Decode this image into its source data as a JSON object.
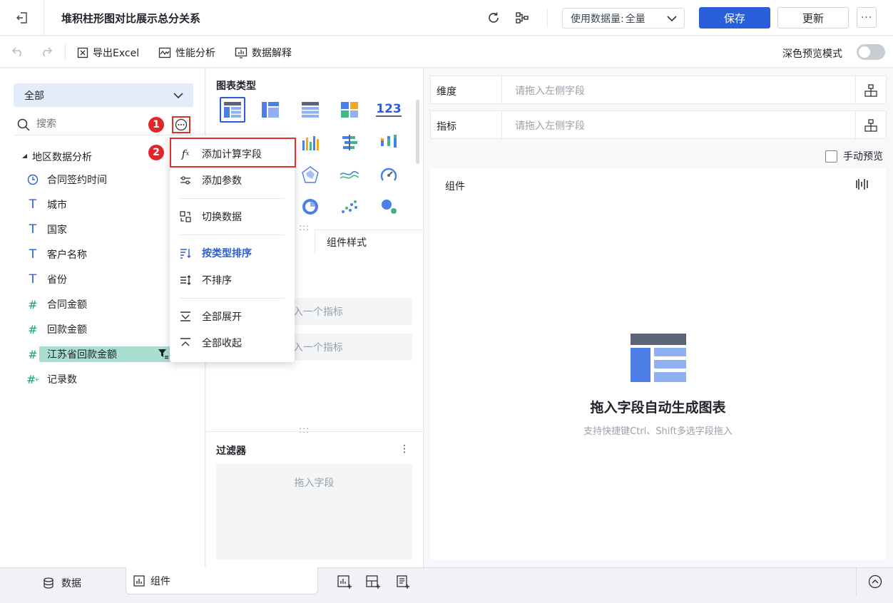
{
  "header": {
    "title": "堆积柱形图对比展示总分关系",
    "usage_label": "使用数据量:",
    "usage_value": "全量",
    "save_label": "保存",
    "update_label": "更新",
    "more_label": "···"
  },
  "toolbar": {
    "export_label": "导出Excel",
    "performance_label": "性能分析",
    "explain_label": "数据解释",
    "dark_mode_label": "深色预览模式",
    "dark_mode_on": false
  },
  "left": {
    "scope": "全部",
    "search_placeholder": "搜索",
    "group": "地区数据分析",
    "fields": [
      {
        "label": "合同签约时间",
        "type": "date"
      },
      {
        "label": "城市",
        "type": "text"
      },
      {
        "label": "国家",
        "type": "text"
      },
      {
        "label": "客户名称",
        "type": "text"
      },
      {
        "label": "省份",
        "type": "text"
      },
      {
        "label": "合同金额",
        "type": "number"
      },
      {
        "label": "回款金额",
        "type": "number"
      },
      {
        "label": "江苏省回款金额",
        "type": "number",
        "selected": true
      },
      {
        "label": "记录数",
        "type": "number-calc"
      }
    ],
    "steps": [
      "1",
      "2"
    ]
  },
  "menu": {
    "items": [
      {
        "label": "添加计算字段",
        "icon": "function-icon"
      },
      {
        "label": "添加参数",
        "icon": "sliders-icon"
      },
      {
        "label": "切换数据",
        "icon": "switch-data-icon"
      },
      {
        "label": "按类型排序",
        "icon": "sort-type-icon",
        "active": true
      },
      {
        "label": "不排序",
        "icon": "no-sort-icon"
      },
      {
        "label": "全部展开",
        "icon": "expand-all-icon"
      },
      {
        "label": "全部收起",
        "icon": "collapse-all-icon"
      }
    ]
  },
  "middle": {
    "chart_type_title": "图表类型",
    "style_tab": "组件样式",
    "drop_indicator_1": "入一个指标",
    "drop_indicator_2": "入一个指标",
    "filter_title": "过滤器",
    "filter_drop": "拖入字段",
    "kpi_label": "123"
  },
  "right": {
    "dimension_label": "维度",
    "dimension_placeholder": "请拖入左侧字段",
    "measure_label": "指标",
    "measure_placeholder": "请拖入左侧字段",
    "manual_preview": "手动预览",
    "canvas_title": "组件",
    "empty_title": "拖入字段自动生成图表",
    "empty_sub": "支持快捷键Ctrl、Shift多选字段拖入"
  },
  "bottom": {
    "data_tab": "数据",
    "component_tab": "组件"
  },
  "colors": {
    "primary": "#2b5fd9",
    "step_badge": "#e0262a",
    "highlight_border": "#e03131",
    "selected_field": "#a9ded1"
  }
}
